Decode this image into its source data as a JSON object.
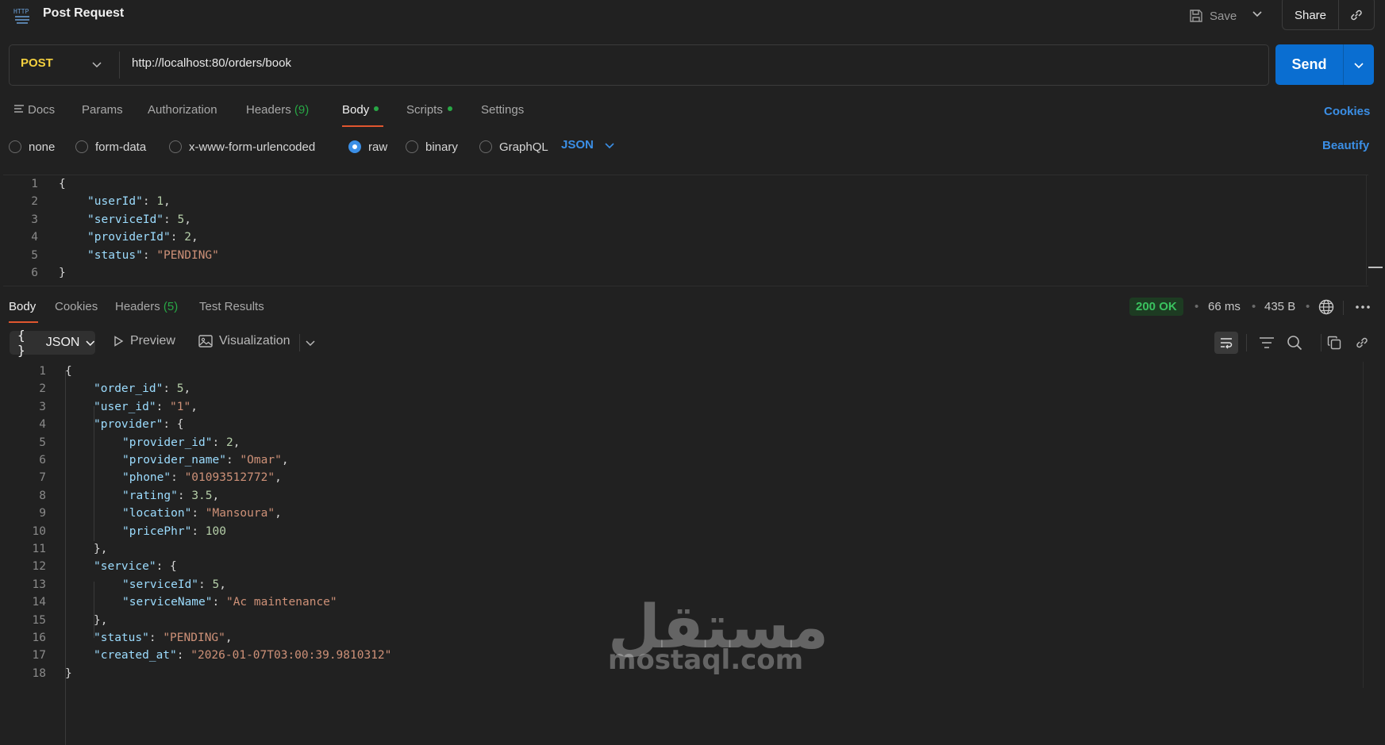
{
  "header": {
    "title": "Post Request",
    "icon_label": "HTTP",
    "save_label": "Save",
    "share_label": "Share"
  },
  "request": {
    "method": "POST",
    "url": "http://localhost:80/orders/book",
    "send_label": "Send"
  },
  "request_tabs": {
    "docs": "Docs",
    "params": "Params",
    "authorization": "Authorization",
    "headers": "Headers",
    "headers_count": "(9)",
    "body": "Body",
    "scripts": "Scripts",
    "settings": "Settings",
    "cookies": "Cookies"
  },
  "body_types": {
    "none": "none",
    "form_data": "form-data",
    "urlencoded": "x-www-form-urlencoded",
    "raw": "raw",
    "binary": "binary",
    "graphql": "GraphQL",
    "selected": "raw",
    "language": "JSON",
    "beautify": "Beautify"
  },
  "request_body": [
    {
      "n": "1",
      "tokens": [
        [
          "p",
          "{"
        ]
      ]
    },
    {
      "n": "2",
      "indent": 1,
      "tokens": [
        [
          "k",
          "\"userId\""
        ],
        [
          "p",
          ": "
        ],
        [
          "n",
          "1"
        ],
        [
          "p",
          ","
        ]
      ]
    },
    {
      "n": "3",
      "indent": 1,
      "tokens": [
        [
          "k",
          "\"serviceId\""
        ],
        [
          "p",
          ": "
        ],
        [
          "n",
          "5"
        ],
        [
          "p",
          ","
        ]
      ]
    },
    {
      "n": "4",
      "indent": 1,
      "tokens": [
        [
          "k",
          "\"providerId\""
        ],
        [
          "p",
          ": "
        ],
        [
          "n",
          "2"
        ],
        [
          "p",
          ","
        ]
      ]
    },
    {
      "n": "5",
      "indent": 1,
      "tokens": [
        [
          "k",
          "\"status\""
        ],
        [
          "p",
          ": "
        ],
        [
          "s",
          "\"PENDING\""
        ]
      ]
    },
    {
      "n": "6",
      "tokens": [
        [
          "p",
          "}"
        ]
      ]
    }
  ],
  "response_tabs": {
    "body": "Body",
    "cookies": "Cookies",
    "headers": "Headers",
    "headers_count": "(5)",
    "test_results": "Test Results"
  },
  "response_meta": {
    "status": "200 OK",
    "time": "66 ms",
    "size": "435 B"
  },
  "response_toolbar": {
    "format": "JSON",
    "preview": "Preview",
    "visualization": "Visualization"
  },
  "response_body": [
    {
      "n": "1",
      "tokens": [
        [
          "p",
          "{"
        ]
      ]
    },
    {
      "n": "2",
      "indent": 1,
      "tokens": [
        [
          "k",
          "\"order_id\""
        ],
        [
          "p",
          ": "
        ],
        [
          "n",
          "5"
        ],
        [
          "p",
          ","
        ]
      ]
    },
    {
      "n": "3",
      "indent": 1,
      "tokens": [
        [
          "k",
          "\"user_id\""
        ],
        [
          "p",
          ": "
        ],
        [
          "s",
          "\"1\""
        ],
        [
          "p",
          ","
        ]
      ]
    },
    {
      "n": "4",
      "indent": 1,
      "tokens": [
        [
          "k",
          "\"provider\""
        ],
        [
          "p",
          ": {"
        ]
      ]
    },
    {
      "n": "5",
      "indent": 2,
      "tokens": [
        [
          "k",
          "\"provider_id\""
        ],
        [
          "p",
          ": "
        ],
        [
          "n",
          "2"
        ],
        [
          "p",
          ","
        ]
      ]
    },
    {
      "n": "6",
      "indent": 2,
      "tokens": [
        [
          "k",
          "\"provider_name\""
        ],
        [
          "p",
          ": "
        ],
        [
          "s",
          "\"Omar\""
        ],
        [
          "p",
          ","
        ]
      ]
    },
    {
      "n": "7",
      "indent": 2,
      "tokens": [
        [
          "k",
          "\"phone\""
        ],
        [
          "p",
          ": "
        ],
        [
          "s",
          "\"01093512772\""
        ],
        [
          "p",
          ","
        ]
      ]
    },
    {
      "n": "8",
      "indent": 2,
      "tokens": [
        [
          "k",
          "\"rating\""
        ],
        [
          "p",
          ": "
        ],
        [
          "n",
          "3.5"
        ],
        [
          "p",
          ","
        ]
      ]
    },
    {
      "n": "9",
      "indent": 2,
      "tokens": [
        [
          "k",
          "\"location\""
        ],
        [
          "p",
          ": "
        ],
        [
          "s",
          "\"Mansoura\""
        ],
        [
          "p",
          ","
        ]
      ]
    },
    {
      "n": "10",
      "indent": 2,
      "tokens": [
        [
          "k",
          "\"pricePhr\""
        ],
        [
          "p",
          ": "
        ],
        [
          "n",
          "100"
        ]
      ]
    },
    {
      "n": "11",
      "indent": 1,
      "tokens": [
        [
          "p",
          "},"
        ]
      ]
    },
    {
      "n": "12",
      "indent": 1,
      "tokens": [
        [
          "k",
          "\"service\""
        ],
        [
          "p",
          ": {"
        ]
      ]
    },
    {
      "n": "13",
      "indent": 2,
      "tokens": [
        [
          "k",
          "\"serviceId\""
        ],
        [
          "p",
          ": "
        ],
        [
          "n",
          "5"
        ],
        [
          "p",
          ","
        ]
      ]
    },
    {
      "n": "14",
      "indent": 2,
      "tokens": [
        [
          "k",
          "\"serviceName\""
        ],
        [
          "p",
          ": "
        ],
        [
          "s",
          "\"Ac maintenance\""
        ]
      ]
    },
    {
      "n": "15",
      "indent": 1,
      "tokens": [
        [
          "p",
          "},"
        ]
      ]
    },
    {
      "n": "16",
      "indent": 1,
      "tokens": [
        [
          "k",
          "\"status\""
        ],
        [
          "p",
          ": "
        ],
        [
          "s",
          "\"PENDING\""
        ],
        [
          "p",
          ","
        ]
      ]
    },
    {
      "n": "17",
      "indent": 1,
      "tokens": [
        [
          "k",
          "\"created_at\""
        ],
        [
          "p",
          ": "
        ],
        [
          "s",
          "\"2026-01-07T03:00:39.9810312\""
        ]
      ]
    },
    {
      "n": "18",
      "tokens": [
        [
          "p",
          "}"
        ]
      ]
    }
  ],
  "watermark": {
    "arabic": "مستقل",
    "latin": "mostaql.com"
  }
}
